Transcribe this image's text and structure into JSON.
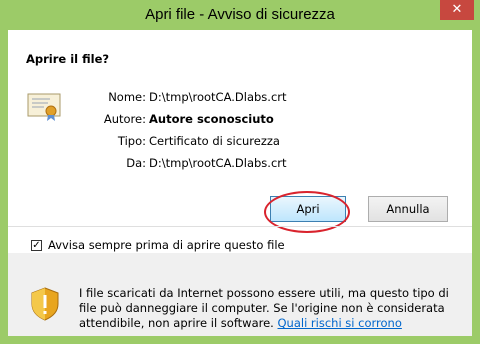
{
  "window": {
    "title": "Apri file - Avviso di sicurezza",
    "close_glyph": "✕"
  },
  "dialog": {
    "question": "Aprire il file?",
    "fields": [
      {
        "label": "Nome:",
        "value": "D:\\tmp\\rootCA.Dlabs.crt"
      },
      {
        "label": "Autore:",
        "value": "Autore sconosciuto"
      },
      {
        "label": "Tipo:",
        "value": "Certificato di sicurezza"
      },
      {
        "label": "Da:",
        "value": "D:\\tmp\\rootCA.Dlabs.crt"
      }
    ],
    "buttons": {
      "open": "Apri",
      "cancel": "Annulla"
    },
    "checkbox": {
      "label": "Avvisa sempre prima di aprire questo file",
      "checked": true,
      "mark": "✓"
    },
    "warning": {
      "text": "I file scaricati da Internet possono essere utili, ma questo tipo di file può danneggiare il computer. Se l'origine non è considerata attendibile, non aprire il software. ",
      "link": "Quali rischi si corrono"
    },
    "icons": {
      "certificate": "certificate-icon",
      "shield": "shield-warning-icon"
    }
  },
  "colors": {
    "titlebar": "#9ccb68",
    "close_button": "#c7483f",
    "highlight": "#d9232d",
    "link": "#0066cc"
  }
}
